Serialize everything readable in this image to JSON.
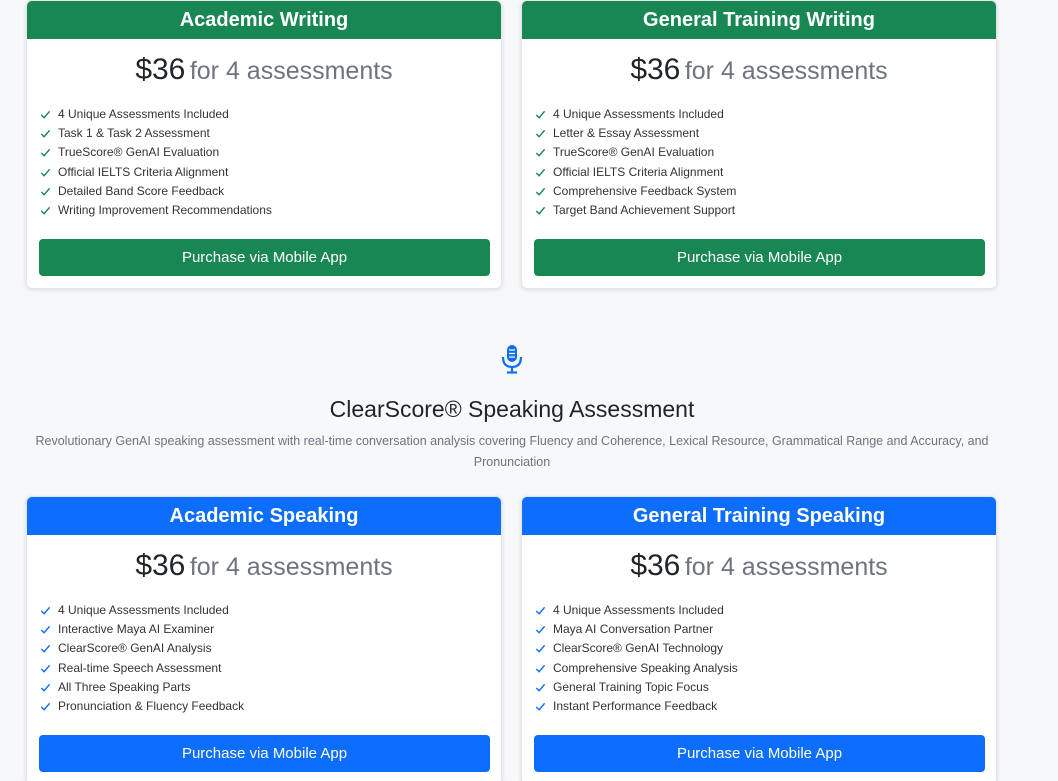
{
  "writing_cards": [
    {
      "title": "Academic Writing",
      "price": "$36",
      "price_suffix": "for 4 assessments",
      "features": [
        "4 Unique Assessments Included",
        "Task 1 & Task 2 Assessment",
        "TrueScore® GenAI Evaluation",
        "Official IELTS Criteria Alignment",
        "Detailed Band Score Feedback",
        "Writing Improvement Recommendations"
      ],
      "button_label": "Purchase via Mobile App"
    },
    {
      "title": "General Training Writing",
      "price": "$36",
      "price_suffix": "for 4 assessments",
      "features": [
        "4 Unique Assessments Included",
        "Letter & Essay Assessment",
        "TrueScore® GenAI Evaluation",
        "Official IELTS Criteria Alignment",
        "Comprehensive Feedback System",
        "Target Band Achievement Support"
      ],
      "button_label": "Purchase via Mobile App"
    }
  ],
  "speaking_section": {
    "icon": "microphone-icon",
    "title": "ClearScore® Speaking Assessment",
    "description": "Revolutionary GenAI speaking assessment with real-time conversation analysis covering Fluency and Coherence, Lexical Resource, Grammatical Range and Accuracy, and Pronunciation"
  },
  "speaking_cards": [
    {
      "title": "Academic Speaking",
      "price": "$36",
      "price_suffix": "for 4 assessments",
      "features": [
        "4 Unique Assessments Included",
        "Interactive Maya AI Examiner",
        "ClearScore® GenAI Analysis",
        "Real-time Speech Assessment",
        "All Three Speaking Parts",
        "Pronunciation & Fluency Feedback"
      ],
      "button_label": "Purchase via Mobile App"
    },
    {
      "title": "General Training Speaking",
      "price": "$36",
      "price_suffix": "for 4 assessments",
      "features": [
        "4 Unique Assessments Included",
        "Maya AI Conversation Partner",
        "ClearScore® GenAI Technology",
        "Comprehensive Speaking Analysis",
        "General Training Topic Focus",
        "Instant Performance Feedback"
      ],
      "button_label": "Purchase via Mobile App"
    }
  ],
  "colors": {
    "writing_accent": "#198754",
    "speaking_accent": "#0d6efd"
  }
}
